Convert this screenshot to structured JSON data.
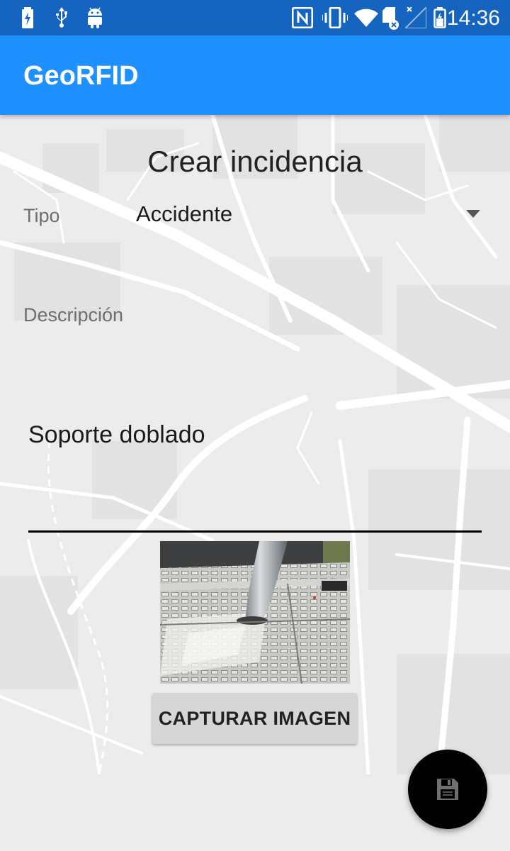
{
  "status_bar": {
    "time": "14:36",
    "icons": [
      "battery-charging-icon",
      "usb-icon",
      "android-icon",
      "nfc-icon",
      "vibrate-icon",
      "wifi-icon",
      "sd-card-icon",
      "signal-icon",
      "battery-icon"
    ]
  },
  "app_bar": {
    "title": "GeoRFID"
  },
  "form": {
    "title": "Crear incidencia",
    "tipo_label": "Tipo",
    "tipo_value": "Accidente",
    "descripcion_label": "Descripción",
    "descripcion_value": "Soporte doblado",
    "capture_button_label": "CAPTURAR IMAGEN"
  },
  "fab": {
    "icon": "save-icon"
  },
  "colors": {
    "status_bar": "#1565c0",
    "app_bar": "#1e90ff",
    "fab": "#000000"
  }
}
